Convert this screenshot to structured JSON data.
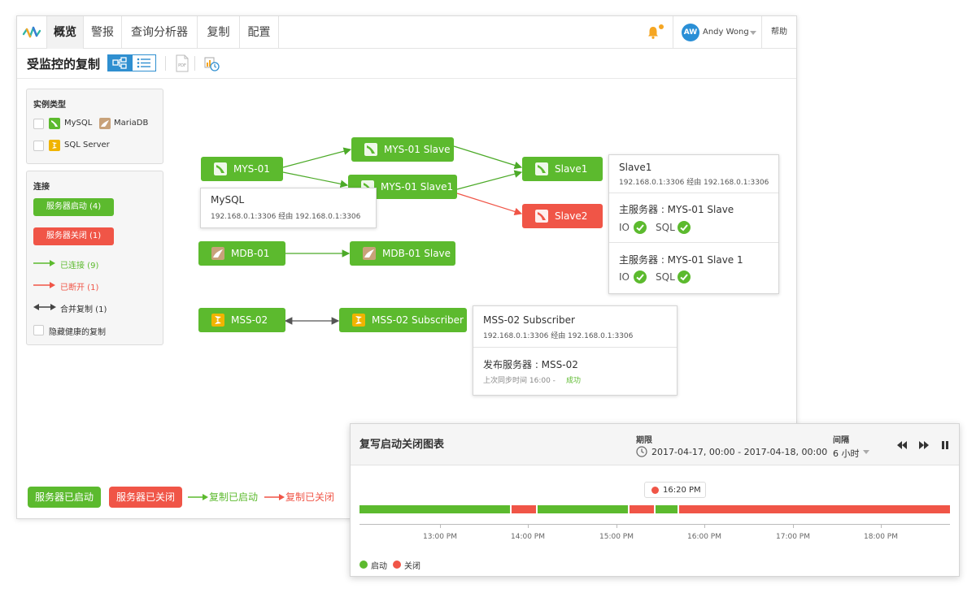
{
  "nav": {
    "tabs": [
      "概览",
      "警报",
      "查询分析器",
      "复制",
      "配置"
    ],
    "active_tab": "概览",
    "user": {
      "initials": "AW",
      "name": "Andy Wong"
    },
    "help": "帮助"
  },
  "toolbar": {
    "title": "受监控的复制",
    "pdf_label": "PDF"
  },
  "filters": {
    "instance_type_title": "实例类型",
    "instance_types": [
      "MySQL",
      "MariaDB",
      "SQL Server"
    ],
    "connections_title": "连接",
    "server_up_label": "服务器启动 (4)",
    "server_down_label": "服务器关闭 (1)",
    "connected_label": "已连接 (9)",
    "disconnected_label": "已断开 (1)",
    "merge_label": "合并复制 (1)",
    "hide_healthy_label": "隐藏健康的复制"
  },
  "nodes": {
    "mys01": "MYS-01",
    "mys01_slave": "MYS-01 Slave",
    "mys01_slave1": "MYS-01 Slave1",
    "slave1": "Slave1",
    "slave2": "Slave2",
    "mdb01": "MDB-01",
    "mdb01_slave": "MDB-01 Slave",
    "mss02": "MSS-02",
    "mss02_subscriber": "MSS-02 Subscriber"
  },
  "cards": {
    "mysql": {
      "title": "MySQL",
      "address": "192.168.0.1:3306 经由 192.168.0.1:3306"
    },
    "slave1": {
      "title": "Slave1",
      "address": "192.168.0.1:3306 经由 192.168.0.1:3306",
      "master1": "主服务器 : MYS-01 Slave",
      "master2": "主服务器 : MYS-01 Slave 1",
      "io": "IO",
      "sql": "SQL"
    },
    "subscriber": {
      "title": "MSS-02 Subscriber",
      "address": "192.168.0.1:3306 经由 192.168.0.1:3306",
      "publisher": "发布服务器 : MSS-02",
      "last_sync": "上次同步时间 16:00 -",
      "status": "成功"
    }
  },
  "legend": {
    "server_up": "服务器已启动",
    "server_down": "服务器已关闭",
    "repl_up": "复制已启动",
    "repl_down": "复制已关闭"
  },
  "timeline": {
    "title": "复写启动关闭图表",
    "period_label": "期限",
    "period_value": "2017-04-17, 00:00 - 2017-04-18, 00:00",
    "interval_label": "间隔",
    "interval_value": "6 小时",
    "marker": "16:20 PM",
    "ticks": [
      "13:00 PM",
      "14:00 PM",
      "15:00 PM",
      "16:00 PM",
      "17:00 PM",
      "18:00 PM"
    ],
    "legend_up": "启动",
    "legend_down": "关闭"
  },
  "colors": {
    "up": "#5cba2e",
    "down": "#f05547",
    "accent": "#2f8fd0"
  }
}
